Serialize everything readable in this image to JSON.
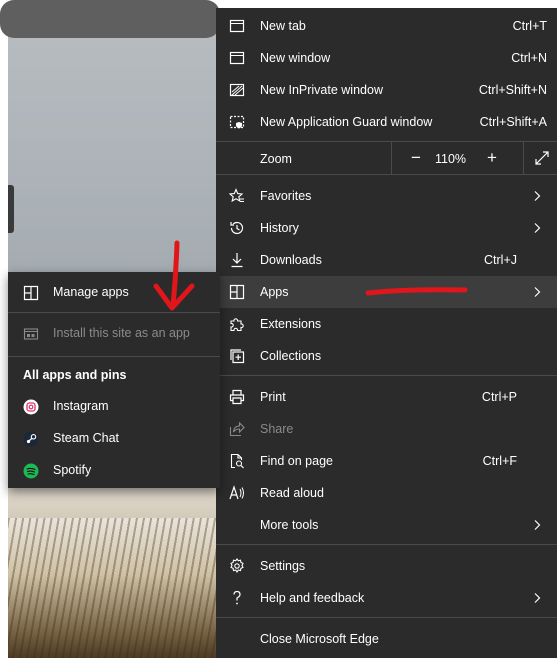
{
  "menu": {
    "items": [
      {
        "label": "New tab",
        "shortcut": "Ctrl+T"
      },
      {
        "label": "New window",
        "shortcut": "Ctrl+N"
      },
      {
        "label": "New InPrivate window",
        "shortcut": "Ctrl+Shift+N"
      },
      {
        "label": "New Application Guard window",
        "shortcut": "Ctrl+Shift+A"
      }
    ],
    "zoom": {
      "label": "Zoom",
      "minus": "−",
      "value": "110%",
      "plus": "+"
    },
    "favorites": "Favorites",
    "history": "History",
    "downloads": {
      "label": "Downloads",
      "shortcut": "Ctrl+J"
    },
    "apps": "Apps",
    "extensions": "Extensions",
    "collections": "Collections",
    "print": {
      "label": "Print",
      "shortcut": "Ctrl+P"
    },
    "share": "Share",
    "find": {
      "label": "Find on page",
      "shortcut": "Ctrl+F"
    },
    "read_aloud": "Read aloud",
    "more_tools": "More tools",
    "settings": "Settings",
    "help": "Help and feedback",
    "close": "Close Microsoft Edge"
  },
  "submenu": {
    "manage": "Manage apps",
    "install": "Install this site as an app",
    "heading": "All apps and pins",
    "apps": [
      {
        "label": "Instagram",
        "icon": "instagram-icon",
        "color": "#e1306c"
      },
      {
        "label": "Steam Chat",
        "icon": "steam-icon",
        "color": "#1b2838"
      },
      {
        "label": "Spotify",
        "icon": "spotify-icon",
        "color": "#1db954"
      }
    ]
  },
  "colors": {
    "menu_bg": "#2b2b2b",
    "highlight": "#3d3d3d",
    "annotation": "#e0161b"
  }
}
